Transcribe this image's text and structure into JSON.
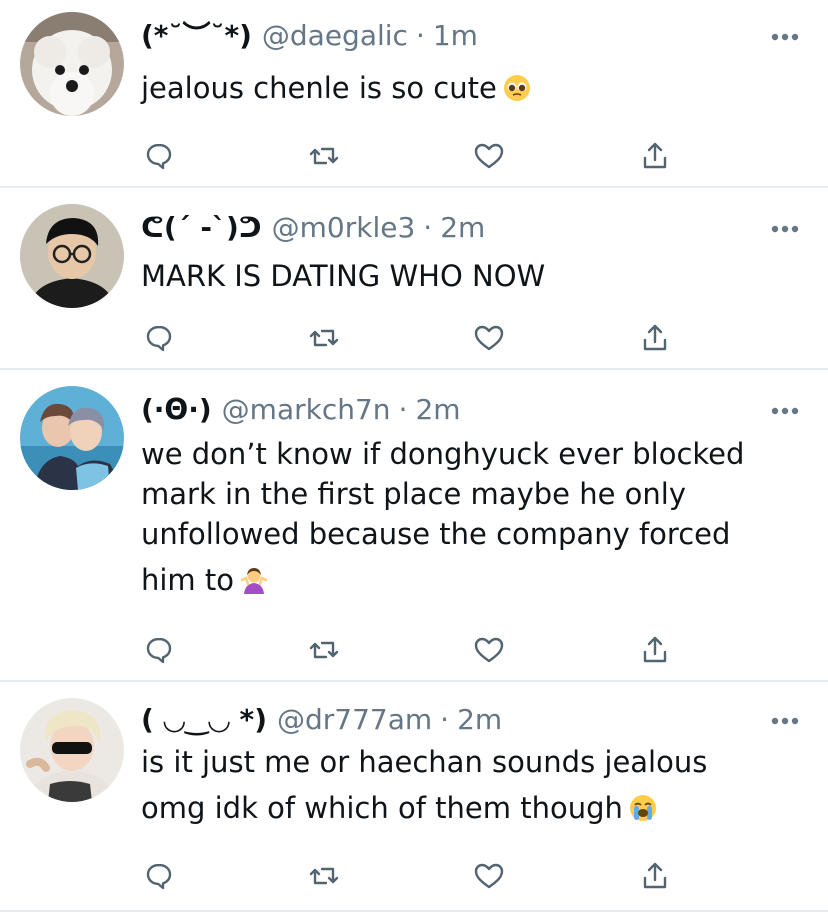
{
  "tweets": [
    {
      "display_name": "(*˘︶˘*)",
      "handle": "@daegalic",
      "separator": "·",
      "time": "1m",
      "lines": [
        "jealous chenle is so cute"
      ],
      "emoji": "pleading-face",
      "avatar": "white-dog-avatar"
    },
    {
      "display_name": "ᕦ(ˊ -ˋ)ᕤ",
      "handle": "@m0rkle3",
      "separator": "·",
      "time": "2m",
      "lines": [
        "MARK IS DATING WHO NOW"
      ],
      "emoji": "",
      "avatar": "person-with-glasses-avatar"
    },
    {
      "display_name": "(·Θ·)",
      "handle": "@markch7n",
      "separator": "·",
      "time": "2m",
      "lines": [
        "we don’t know if donghyuck ever blocked",
        "mark in the first place maybe he only",
        "unfollowed because the company forced",
        "him to"
      ],
      "emoji": "person-shrugging",
      "avatar": "two-people-avatar"
    },
    {
      "display_name": "( ◡‿◡ *)",
      "handle": "@dr777am",
      "separator": "·",
      "time": "2m",
      "lines": [
        "is it just me or haechan sounds jealous",
        "omg idk of which of them though"
      ],
      "emoji": "loudly-crying-face",
      "avatar": "blond-person-sunglasses-avatar"
    }
  ],
  "actions": [
    "reply-icon",
    "retweet-icon",
    "like-icon",
    "share-icon"
  ],
  "colors": {
    "text": "#0f1419",
    "secondary": "#657786",
    "icon": "#536471",
    "divider": "#e6ecf0"
  }
}
